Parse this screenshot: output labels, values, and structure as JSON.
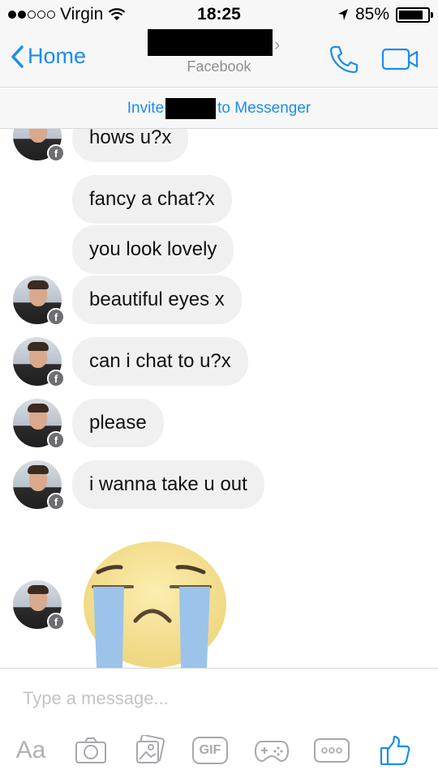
{
  "status_bar": {
    "carrier": "Virgin",
    "time": "18:25",
    "battery": "85%",
    "battery_level": 0.85
  },
  "nav": {
    "back_label": "Home",
    "subtitle": "Facebook"
  },
  "invite": {
    "prefix": "Invite",
    "suffix": "to Messenger"
  },
  "messages": [
    {
      "text": "hows u?x"
    },
    {
      "text": "fancy a chat?x"
    },
    {
      "text": "you look lovely"
    },
    {
      "text": "beautiful eyes x"
    },
    {
      "text": "can i chat to u?x"
    },
    {
      "text": "please"
    },
    {
      "text": "i wanna take u out"
    }
  ],
  "emoji_message": {
    "icon": "crying-face-sticker"
  },
  "composer": {
    "placeholder": "Type a message...",
    "aa_label": "Aa",
    "gif_label": "GIF",
    "tools": [
      "camera-icon",
      "gallery-icon",
      "gif-icon",
      "game-icon",
      "more-icon",
      "like-icon"
    ]
  },
  "colors": {
    "accent": "#1a8cf0",
    "bubble": "#f0f0f0",
    "emoji_yellow": "#f3dd8a",
    "tear_blue": "#9cc3ea"
  }
}
